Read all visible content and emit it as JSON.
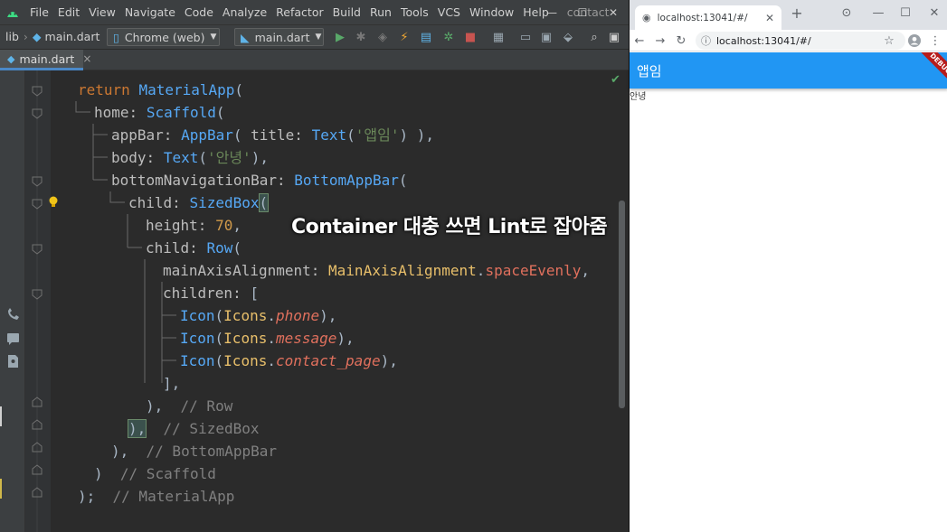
{
  "ide": {
    "menu": [
      "File",
      "Edit",
      "View",
      "Navigate",
      "Code",
      "Analyze",
      "Refactor",
      "Build",
      "Run",
      "Tools",
      "VCS",
      "Window",
      "Help"
    ],
    "project_name": "contact",
    "window_controls": {
      "minimize": "—",
      "maximize": "☐",
      "close": "✕"
    },
    "breadcrumb": {
      "folder": "lib",
      "file": "main.dart"
    },
    "device_selector": "Chrome (web)",
    "run_config": "main.dart",
    "tab_label": "main.dart",
    "caption": "Container 대충 쓰면 Lint로 잡아줌",
    "code": {
      "l1_kw": "return",
      "l1_cls": "MaterialApp",
      "l1_p": "(",
      "l2_prm": "home:",
      "l2_cls": "Scaffold",
      "l2_p": "(",
      "l3_prm": "appBar:",
      "l3_cls": "AppBar",
      "l3_a": "( ",
      "l3_prm2": "title:",
      "l3_cls2": "Text",
      "l3_p": "(",
      "l3_str": "'앱임'",
      "l3_end": ") ),",
      "l4_prm": "body:",
      "l4_cls": "Text",
      "l4_p": "(",
      "l4_str": "'안녕'",
      "l4_end": "),",
      "l5_prm": "bottomNavigationBar:",
      "l5_cls": "BottomAppBar",
      "l5_p": "(",
      "l6_prm": "child:",
      "l6_cls": "SizedBox",
      "l6_p": "(",
      "l7_prm": "height:",
      "l7_num": "70",
      "l7_end": ",",
      "l8_prm": "child:",
      "l8_cls": "Row",
      "l8_p": "(",
      "l9_prm": "mainAxisAlignment:",
      "l9_enum": "MainAxisAlignment",
      "l9_dot": ".",
      "l9_fld": "spaceEvenly",
      "l9_end": ",",
      "l10_prm": "children:",
      "l10_p": "[",
      "l11_cls": "Icon",
      "l11_a": "(",
      "l11_ico": "Icons",
      "l11_dot": ".",
      "l11_fld": "phone",
      "l11_end": "),",
      "l12_cls": "Icon",
      "l12_a": "(",
      "l12_ico": "Icons",
      "l12_dot": ".",
      "l12_fld": "message",
      "l12_end": "),",
      "l13_cls": "Icon",
      "l13_a": "(",
      "l13_ico": "Icons",
      "l13_dot": ".",
      "l13_fld": "contact_page",
      "l13_end": "),",
      "l14": "],",
      "l15_p": "),",
      "l15_cmt": "// Row",
      "l16_p": "),",
      "l16_cmt": "// SizedBox",
      "l17_p": "),",
      "l17_cmt": "// BottomAppBar",
      "l18_p": ")",
      "l18_cmt": "// Scaffold",
      "l19_p": ");",
      "l19_cmt": "// MaterialApp"
    }
  },
  "browser": {
    "tab_title": "localhost:13041/#/",
    "url": "localhost:13041/#/",
    "new_tab": "+",
    "controls": {
      "minimize": "—",
      "maximize": "☐",
      "close": "✕"
    },
    "app_title": "앱임",
    "debug_banner": "DEBUG",
    "body_text": "안녕"
  },
  "colors": {
    "appbar": "#2196f3",
    "ide_bg": "#2b2b2b",
    "tab_accent": "#4a88c7"
  }
}
